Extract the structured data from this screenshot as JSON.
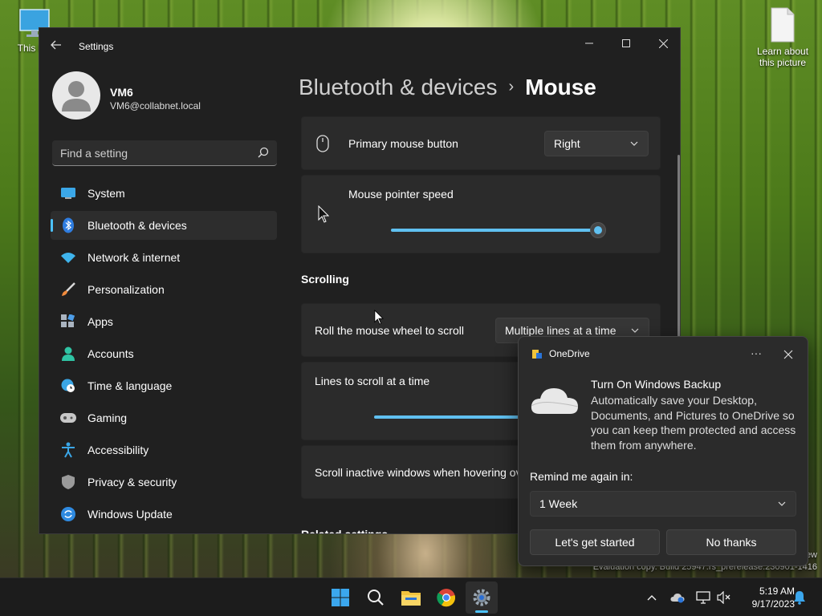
{
  "desktop": {
    "icons": [
      {
        "label": "This PC",
        "icon": "monitor-icon"
      },
      {
        "label": "Learn about this picture",
        "icon": "file-icon"
      }
    ],
    "watermark_line1": "ew",
    "watermark_line2": "Evaluation copy. Build 25947.rs_prerelease.230901-1416"
  },
  "window": {
    "title": "Settings",
    "user": {
      "name": "VM6",
      "email": "VM6@collabnet.local"
    },
    "search": {
      "placeholder": "Find a setting"
    },
    "nav": [
      {
        "label": "System",
        "icon": "system-icon"
      },
      {
        "label": "Bluetooth & devices",
        "icon": "bluetooth-icon",
        "selected": true
      },
      {
        "label": "Network & internet",
        "icon": "wifi-icon"
      },
      {
        "label": "Personalization",
        "icon": "brush-icon"
      },
      {
        "label": "Apps",
        "icon": "apps-icon"
      },
      {
        "label": "Accounts",
        "icon": "person-icon"
      },
      {
        "label": "Time & language",
        "icon": "globe-clock-icon"
      },
      {
        "label": "Gaming",
        "icon": "gamepad-icon"
      },
      {
        "label": "Accessibility",
        "icon": "accessibility-icon"
      },
      {
        "label": "Privacy & security",
        "icon": "shield-icon"
      },
      {
        "label": "Windows Update",
        "icon": "update-icon"
      }
    ],
    "breadcrumb": {
      "parent": "Bluetooth & devices",
      "separator": "›",
      "current": "Mouse"
    },
    "settings": {
      "primary_button_label": "Primary mouse button",
      "primary_button_value": "Right",
      "pointer_speed_label": "Mouse pointer speed",
      "pointer_speed_level": 1.0,
      "scrolling_heading": "Scrolling",
      "roll_wheel_label": "Roll the mouse wheel to scroll",
      "roll_wheel_value": "Multiple lines at a time",
      "lines_to_scroll_label": "Lines to scroll at a time",
      "inactive_scroll_label": "Scroll inactive windows when hovering ov",
      "related_heading": "Related settings"
    }
  },
  "onedrive": {
    "title": "OneDrive",
    "heading": "Turn On Windows Backup",
    "body": "Automatically save your Desktop, Documents, and Pictures to OneDrive so you can keep them protected and access them from anywhere.",
    "remind_label": "Remind me again in:",
    "remind_value": "1 Week",
    "primary_button": "Let's get started",
    "secondary_button": "No thanks"
  },
  "taskbar": {
    "apps": [
      "start-icon",
      "search-icon",
      "file-explorer-icon",
      "chrome-icon",
      "settings-icon"
    ],
    "time": "5:19 AM",
    "date": "9/17/2023"
  },
  "colors": {
    "accent": "#4cc2ff",
    "slider": "#60c0f0",
    "window_bg": "#202020",
    "card_bg": "#2b2b2b"
  }
}
